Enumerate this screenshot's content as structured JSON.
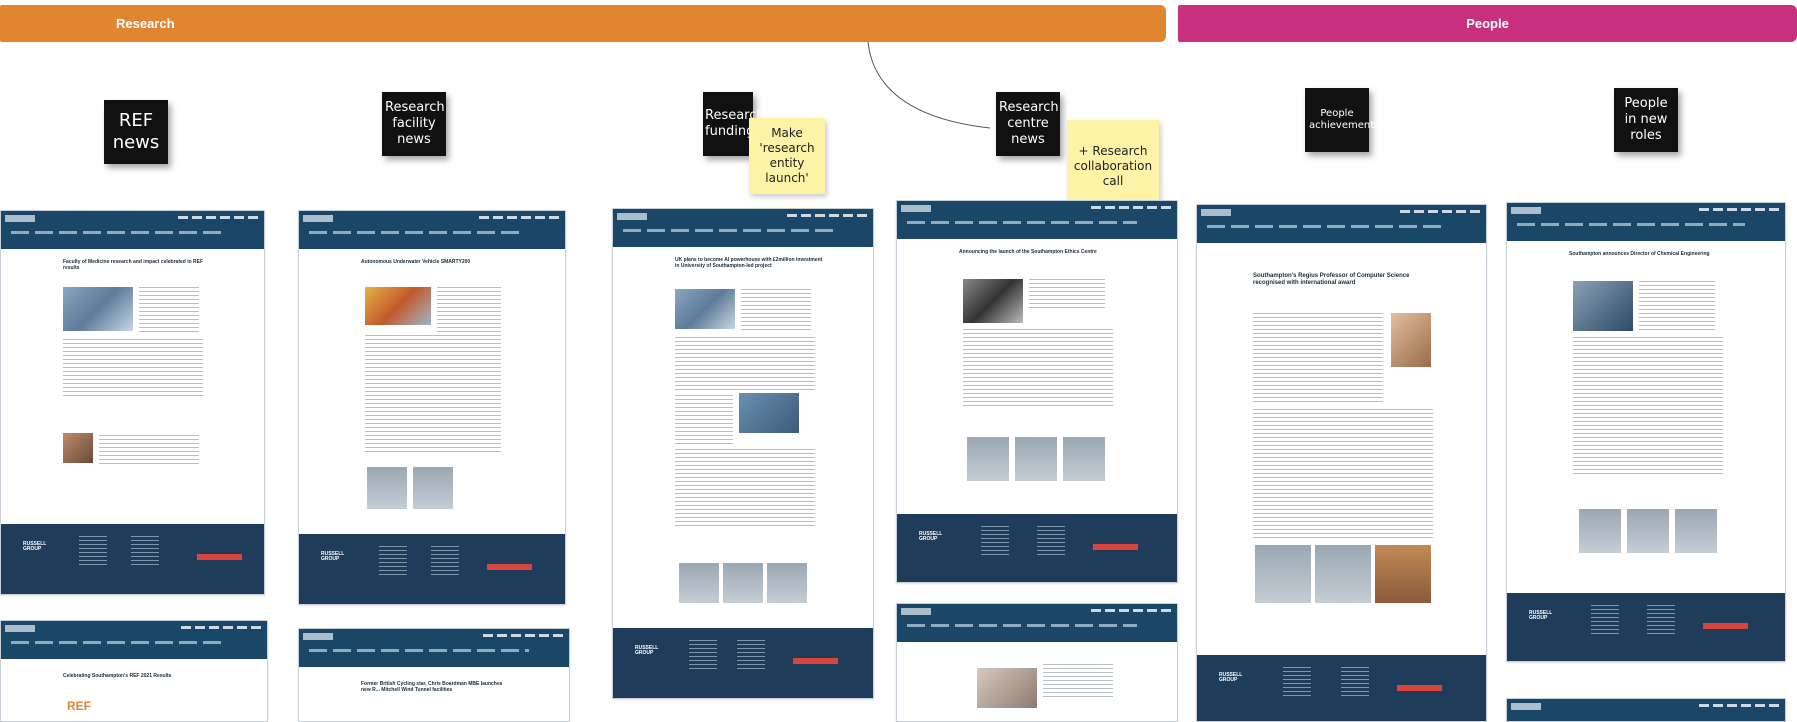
{
  "banners": {
    "research": "Research",
    "people": "People"
  },
  "notes": {
    "ref_news": "REF news",
    "research_facility_news": "Research facility news",
    "research_funding": "Research funding",
    "make_research_entity_launch": "Make 'research entity launch'",
    "research_centre_news": "Research centre news",
    "research_collaboration_call": "+ Research collaboration call",
    "people_achievements": "People achievements",
    "people_in_new_roles": "People in new roles"
  },
  "pages": {
    "ref_page_title": "Faculty of Medicine research and impact celebrated in REF results",
    "ref_page2_title": "Celebrating Southampton's REF 2021 Results",
    "facility_page_title": "Autonomous Underwater Vehicle SMARTY200",
    "facility_page2_title": "Former British Cycling star, Chris Boardman MBE launches new R... Mitchell Wind Tunnel facilities",
    "funding_page_title": "UK plans to become AI powerhouse with £2million investment in University of Southampton-led project",
    "centre_page_title": "Announcing the launch of the Southampton Ethics Centre",
    "achievements_page_title": "Southampton's Regius Professor of Computer Science recognised with international award",
    "roles_page_title": "Southampton announces Director of Chemical Engineering",
    "footer_group": "RUSSELL GROUP"
  },
  "colors": {
    "research_banner": "#e08530",
    "people_banner": "#c6307e",
    "page_nav": "#1a4768",
    "page_footer": "#1f3d5a"
  }
}
